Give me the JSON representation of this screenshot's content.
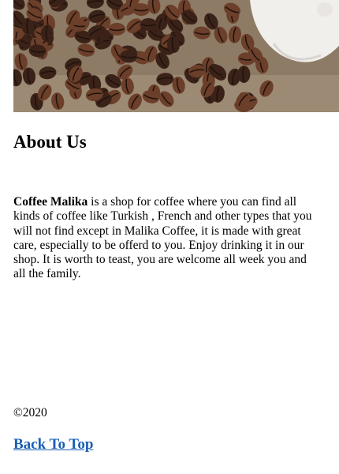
{
  "hero": {
    "image_alt": "coffee-beans-image",
    "colors": {
      "bean": "#3b2218",
      "bean_highlight": "#6b3f2a",
      "wood": "#9c8a74",
      "cup": "#f4f2ef"
    }
  },
  "about": {
    "title": "About Us",
    "brand": "Coffee Malika",
    "body": " is a shop for coffee where you can find all kinds of coffee like Turkish , French and other types that you will not find except in Malika Coffee, it is made with great care, especially to be offerd to you. Enjoy drinking it in our shop. It is worth to teast, you are welcome all week you and all the family."
  },
  "footer": {
    "copyright": "©2020",
    "back_to_top": "Back To Top",
    "link_color": "#1a5fb4"
  }
}
